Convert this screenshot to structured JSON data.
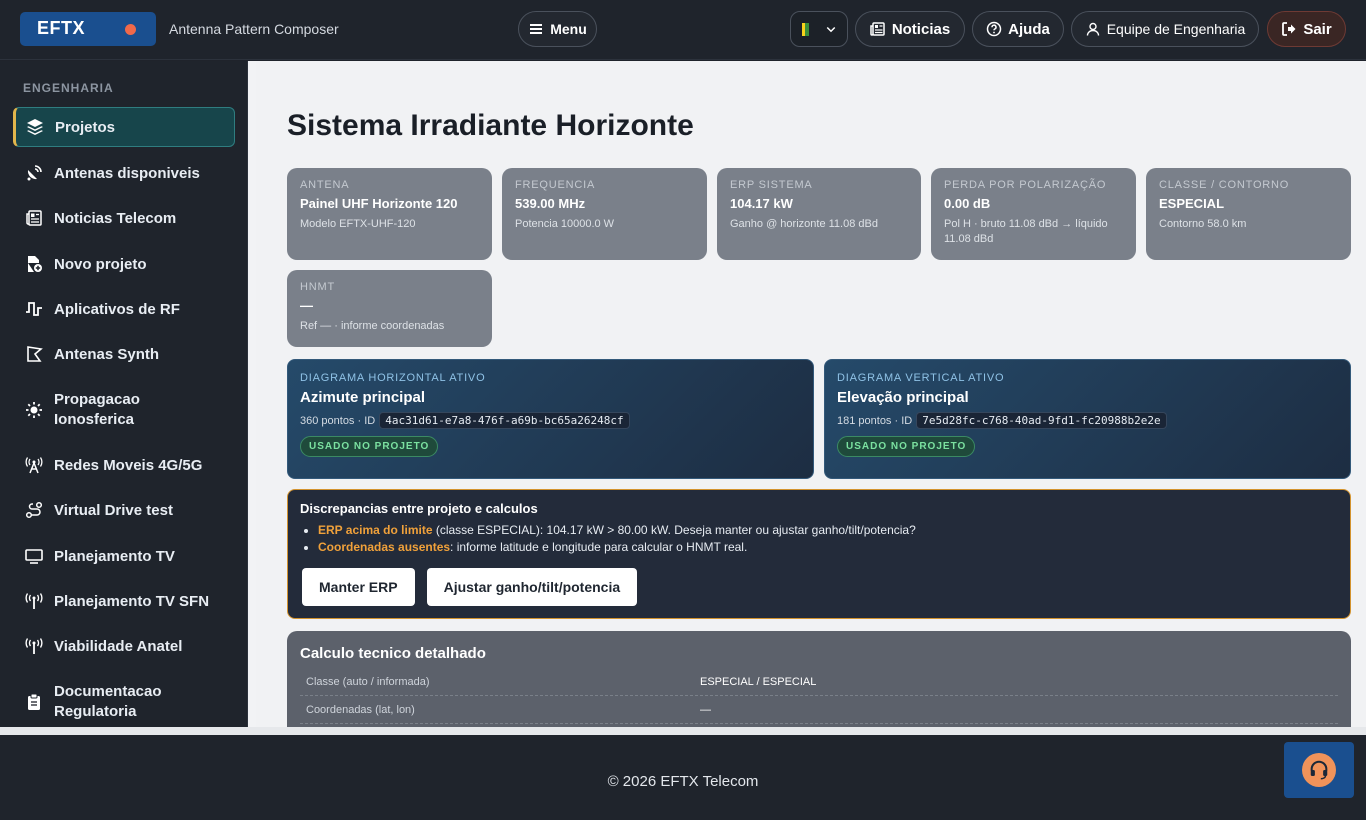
{
  "header": {
    "brand": "EFTX",
    "subtitle": "Antenna Pattern Composer",
    "menu_label": "Menu",
    "news_label": "Noticias",
    "help_label": "Ajuda",
    "team_label": "Equipe de Engenharia",
    "logout_label": "Sair"
  },
  "sidebar": {
    "section": "ENGENHARIA",
    "items": [
      {
        "label": "Projetos",
        "icon": "layers-icon"
      },
      {
        "label": "Antenas disponiveis",
        "icon": "satellite-dish-icon"
      },
      {
        "label": "Noticias Telecom",
        "icon": "newspaper-icon"
      },
      {
        "label": "Novo projeto",
        "icon": "new-file-icon"
      },
      {
        "label": "Aplicativos de RF",
        "icon": "pulse-icon"
      },
      {
        "label": "Antenas Synth",
        "icon": "shape-icon"
      },
      {
        "label": "Propagacao Ionosferica",
        "icon": "sun-icon"
      },
      {
        "label": "Redes Moveis 4G/5G",
        "icon": "cell-tower-icon"
      },
      {
        "label": "Virtual Drive test",
        "icon": "route-icon"
      },
      {
        "label": "Planejamento TV",
        "icon": "tv-icon"
      },
      {
        "label": "Planejamento TV SFN",
        "icon": "antenna-icon"
      },
      {
        "label": "Viabilidade Anatel",
        "icon": "antenna-icon"
      },
      {
        "label": "Documentacao Regulatoria",
        "icon": "clipboard-icon"
      }
    ]
  },
  "main": {
    "title": "Sistema Irradiante Horizonte",
    "cards": [
      {
        "label": "ANTENA",
        "value": "Painel UHF Horizonte 120",
        "sub": "Modelo EFTX-UHF-120"
      },
      {
        "label": "FREQUENCIA",
        "value": "539.00 MHz",
        "sub": "Potencia 10000.0 W"
      },
      {
        "label": "ERP SISTEMA",
        "value": "104.17 kW",
        "sub": "Ganho @ horizonte 11.08 dBd"
      },
      {
        "label": "PERDA POR POLARIZAÇÃO",
        "value": "0.00 dB",
        "sub": "Pol H · bruto 11.08 dBd → líquido 11.08 dBd"
      },
      {
        "label": "CLASSE / CONTORNO",
        "value": "ESPECIAL",
        "sub": "Contorno 58.0 km"
      },
      {
        "label": "HNMT",
        "value": "—",
        "sub": "Ref — · informe coordenadas"
      }
    ],
    "diagrams": [
      {
        "label": "DIAGRAMA HORIZONTAL ATIVO",
        "title": "Azimute principal",
        "points": "360 pontos · ID",
        "id": "4ac31d61-e7a8-476f-a69b-bc65a26248cf",
        "badge": "USADO NO PROJETO"
      },
      {
        "label": "DIAGRAMA VERTICAL ATIVO",
        "title": "Elevação principal",
        "points": "181 pontos · ID",
        "id": "7e5d28fc-c768-40ad-9fd1-fc20988b2e2e",
        "badge": "USADO NO PROJETO"
      }
    ],
    "warning": {
      "title": "Discrepancias entre projeto e calculos",
      "items": [
        {
          "highlight": "ERP acima do limite",
          "text": " (classe ESPECIAL): 104.17 kW > 80.00 kW. Deseja manter ou ajustar ganho/tilt/potencia?"
        },
        {
          "highlight": "Coordenadas ausentes",
          "text": ": informe latitude e longitude para calcular o HNMT real."
        }
      ],
      "keep_button": "Manter ERP",
      "adjust_button": "Ajustar ganho/tilt/potencia"
    },
    "calc": {
      "title": "Calculo tecnico detalhado",
      "rows": [
        {
          "key": "Classe (auto / informada)",
          "value": "ESPECIAL / ESPECIAL"
        },
        {
          "key": "Coordenadas (lat, lon)",
          "value": "—"
        }
      ]
    }
  },
  "footer": {
    "copyright": "© 2026 EFTX Telecom",
    "support_icon": "headset-icon"
  },
  "colors": {
    "brand": "#1a4f8f",
    "active_item": "#17454b",
    "warning_accent": "#d3932e",
    "badge_green": "#7be1a0"
  }
}
